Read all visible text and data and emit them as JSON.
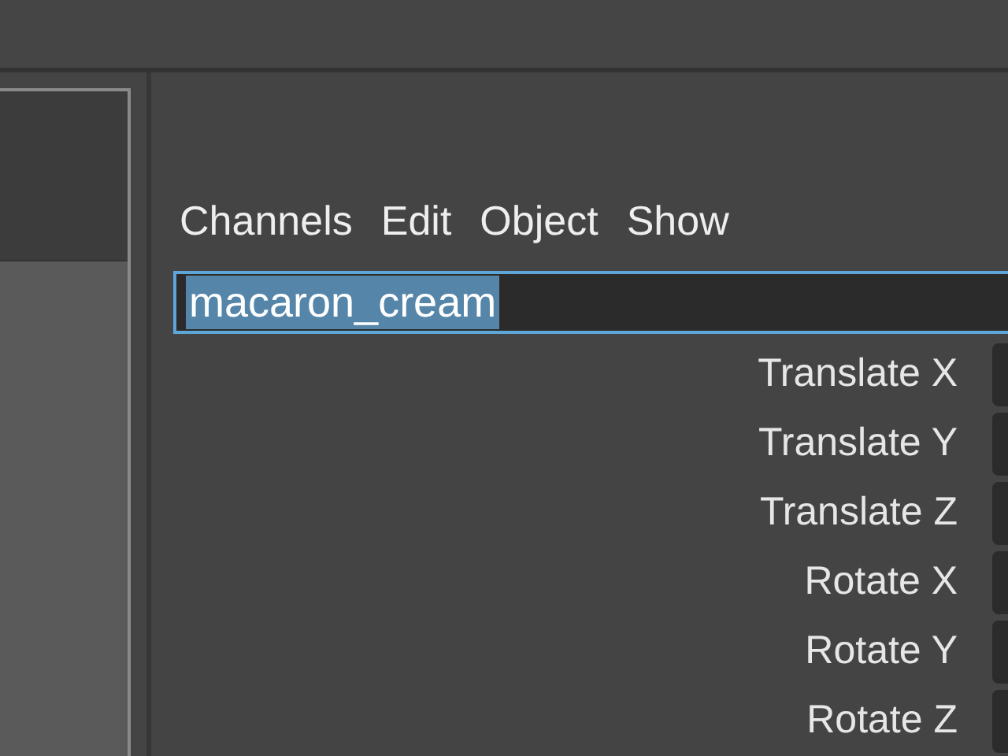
{
  "menu": [
    "Channels",
    "Edit",
    "Object",
    "Show"
  ],
  "name_field": {
    "value": "macaron_cream",
    "text_selected": true
  },
  "channels": [
    {
      "label": "Translate X"
    },
    {
      "label": "Translate Y"
    },
    {
      "label": "Translate Z"
    },
    {
      "label": "Rotate X"
    },
    {
      "label": "Rotate Y"
    },
    {
      "label": "Rotate Z"
    }
  ]
}
